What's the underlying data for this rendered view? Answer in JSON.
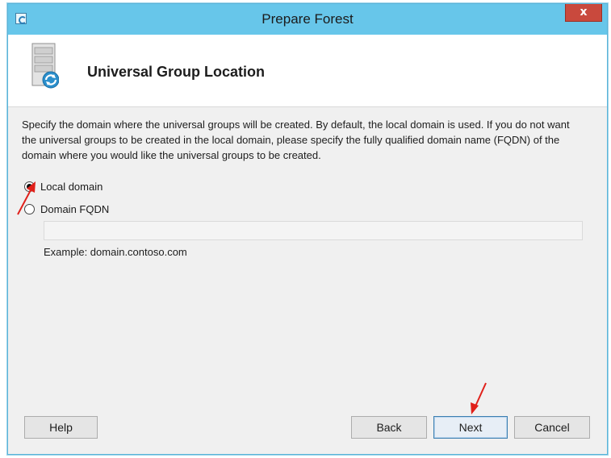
{
  "window": {
    "title": "Prepare Forest",
    "close_label": "x"
  },
  "header": {
    "title": "Universal Group Location",
    "icon": "server-sync-icon"
  },
  "description": "Specify the domain where the universal groups will be created. By default, the local domain is used. If you do not want the universal groups to be created in the local domain, please specify the fully qualified domain name (FQDN) of the domain where you would like the universal groups to be created.",
  "options": [
    {
      "label": "Local domain",
      "checked": true
    },
    {
      "label": "Domain FQDN",
      "checked": false
    }
  ],
  "fqdn_input": {
    "value": "",
    "placeholder": ""
  },
  "example": "Example: domain.contoso.com",
  "buttons": {
    "help": "Help",
    "back": "Back",
    "next": "Next",
    "cancel": "Cancel"
  },
  "colors": {
    "titlebar": "#67c6ea",
    "close": "#c9493d",
    "annotation_arrow": "#e0201a"
  }
}
